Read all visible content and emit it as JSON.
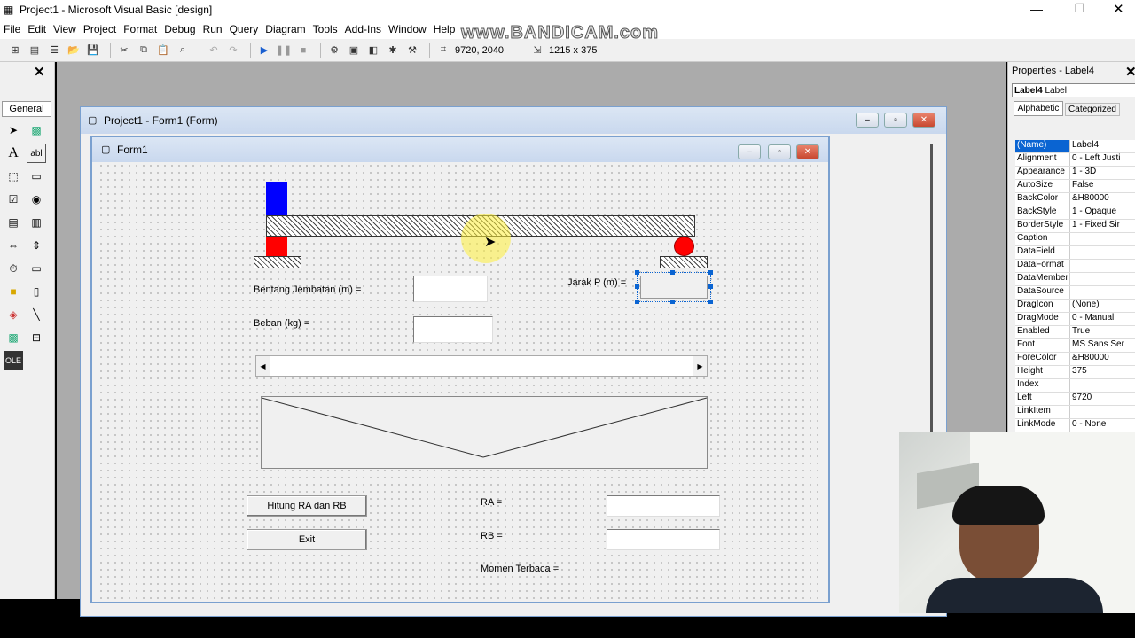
{
  "window": {
    "title": "Project1 - Microsoft Visual Basic [design]"
  },
  "menu": [
    "File",
    "Edit",
    "View",
    "Project",
    "Format",
    "Debug",
    "Run",
    "Query",
    "Diagram",
    "Tools",
    "Add-Ins",
    "Window",
    "Help"
  ],
  "toolbar": {
    "position": "9720, 2040",
    "size": "1215 x 375"
  },
  "watermark": "www.BANDICAM.com",
  "toolbox": {
    "title": "General"
  },
  "design_window": {
    "title": "Project1 - Form1 (Form)"
  },
  "form": {
    "title": "Form1",
    "labels": {
      "bentang": "Bentang Jembatan (m) =",
      "beban": "Beban  (kg) =",
      "jarak": "Jarak P (m) =",
      "ra": "RA =",
      "rb": "RB =",
      "momen": "Momen Terbaca ="
    },
    "buttons": {
      "hitung": "Hitung RA dan RB",
      "exit": "Exit"
    }
  },
  "properties": {
    "title": "Properties - Label4",
    "object": "Label4",
    "object_type": "Label",
    "tabs": [
      "Alphabetic",
      "Categorized"
    ],
    "rows": [
      {
        "k": "(Name)",
        "v": "Label4"
      },
      {
        "k": "Alignment",
        "v": "0 - Left Justi"
      },
      {
        "k": "Appearance",
        "v": "1 - 3D"
      },
      {
        "k": "AutoSize",
        "v": "False"
      },
      {
        "k": "BackColor",
        "v": "&H80000"
      },
      {
        "k": "BackStyle",
        "v": "1 - Opaque"
      },
      {
        "k": "BorderStyle",
        "v": "1 - Fixed Sir"
      },
      {
        "k": "Caption",
        "v": ""
      },
      {
        "k": "DataField",
        "v": ""
      },
      {
        "k": "DataFormat",
        "v": ""
      },
      {
        "k": "DataMember",
        "v": ""
      },
      {
        "k": "DataSource",
        "v": ""
      },
      {
        "k": "DragIcon",
        "v": "(None)"
      },
      {
        "k": "DragMode",
        "v": "0 - Manual"
      },
      {
        "k": "Enabled",
        "v": "True"
      },
      {
        "k": "Font",
        "v": "MS Sans Ser"
      },
      {
        "k": "ForeColor",
        "v": "&H80000"
      },
      {
        "k": "Height",
        "v": "375"
      },
      {
        "k": "Index",
        "v": ""
      },
      {
        "k": "Left",
        "v": "9720"
      },
      {
        "k": "LinkItem",
        "v": ""
      },
      {
        "k": "LinkMode",
        "v": "0 - None"
      }
    ]
  },
  "colors": {
    "accent": "#0a64d2",
    "support_blue": "#0000ff",
    "support_red": "#ff0000"
  }
}
